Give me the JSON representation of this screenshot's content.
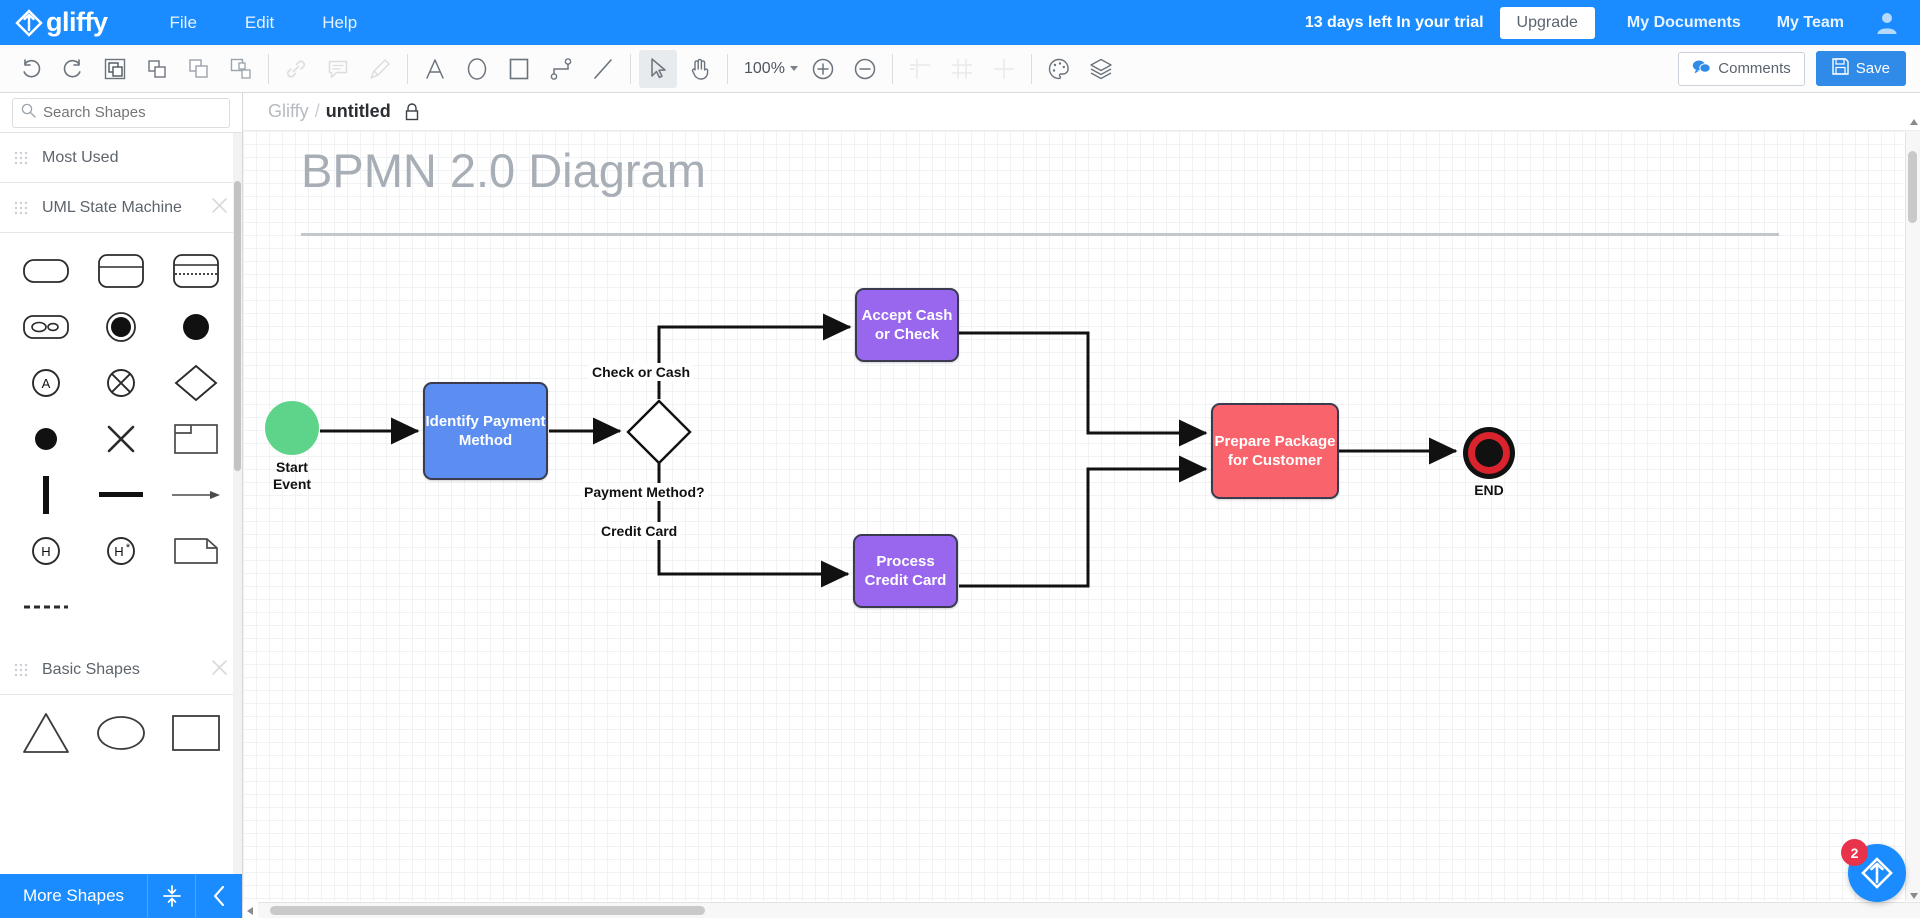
{
  "header": {
    "logo_text": "gliffy",
    "logo_icon": "gliffy-logo-icon",
    "menu": [
      {
        "label": "File"
      },
      {
        "label": "Edit"
      },
      {
        "label": "Help"
      }
    ],
    "trial_text": "13 days left In your trial",
    "upgrade_label": "Upgrade",
    "my_documents_label": "My Documents",
    "my_team_label": "My Team",
    "avatar_icon": "user-avatar-icon"
  },
  "toolbar": {
    "groups": [
      {
        "name": "history-and-arrange",
        "buttons": [
          {
            "name": "undo-button",
            "icon": "undo-icon",
            "enabled": true
          },
          {
            "name": "redo-button",
            "icon": "redo-icon",
            "enabled": true
          },
          {
            "name": "bring-to-front-button",
            "icon": "bring-to-front-icon",
            "enabled": true
          },
          {
            "name": "bring-forward-button",
            "icon": "bring-forward-icon",
            "enabled": true
          },
          {
            "name": "send-backward-button",
            "icon": "send-backward-icon",
            "enabled": true
          },
          {
            "name": "send-to-back-button",
            "icon": "send-to-back-icon",
            "enabled": true
          }
        ]
      },
      {
        "name": "object-actions",
        "buttons": [
          {
            "name": "link-button",
            "icon": "link-icon",
            "enabled": false
          },
          {
            "name": "comment-button",
            "icon": "comment-icon",
            "enabled": false
          },
          {
            "name": "format-painter-button",
            "icon": "format-painter-icon",
            "enabled": false
          }
        ]
      },
      {
        "name": "insert-shapes",
        "buttons": [
          {
            "name": "text-tool-button",
            "icon": "text-a-icon",
            "enabled": true
          },
          {
            "name": "ellipse-tool-button",
            "icon": "ellipse-icon",
            "enabled": true
          },
          {
            "name": "rectangle-tool-button",
            "icon": "rectangle-icon",
            "enabled": true
          },
          {
            "name": "connector-tool-button",
            "icon": "elbow-connector-icon",
            "enabled": true
          },
          {
            "name": "line-tool-button",
            "icon": "line-icon",
            "enabled": true
          }
        ]
      },
      {
        "name": "pointer-tools",
        "buttons": [
          {
            "name": "select-tool-button",
            "icon": "cursor-arrow-icon",
            "enabled": true,
            "active": true
          },
          {
            "name": "pan-tool-button",
            "icon": "hand-icon",
            "enabled": true
          }
        ]
      },
      {
        "name": "zoom-tools",
        "zoom_level": "100%",
        "buttons": [
          {
            "name": "zoom-in-button",
            "icon": "zoom-in-icon",
            "enabled": true
          },
          {
            "name": "zoom-out-button",
            "icon": "zoom-out-icon",
            "enabled": true
          }
        ]
      },
      {
        "name": "guides-and-grid",
        "buttons": [
          {
            "name": "rulers-button",
            "icon": "rulers-icon",
            "enabled": true
          },
          {
            "name": "grid-button",
            "icon": "grid-icon",
            "enabled": true
          },
          {
            "name": "snap-button",
            "icon": "snap-crosshair-icon",
            "enabled": true
          }
        ]
      },
      {
        "name": "style-tools",
        "buttons": [
          {
            "name": "theme-button",
            "icon": "palette-icon",
            "enabled": true
          },
          {
            "name": "layers-button",
            "icon": "layers-icon",
            "enabled": true
          }
        ]
      }
    ],
    "comments_label": "Comments",
    "comments_icon": "comments-bubble-icon",
    "save_label": "Save",
    "save_icon": "floppy-disk-icon"
  },
  "sidebar": {
    "search": {
      "placeholder": "Search Shapes",
      "value": "",
      "icon": "search-icon"
    },
    "sections": [
      {
        "name": "most-used",
        "title": "Most Used",
        "closable": false,
        "shapes": []
      },
      {
        "name": "uml-state-machine",
        "title": "UML State Machine",
        "closable": true,
        "shapes": [
          "rounded-rect-icon",
          "rounded-rect-divided-icon",
          "rounded-rect-dashed-icon",
          "composite-state-icon",
          "initial-state-ring-icon",
          "filled-circle-icon",
          "circle-a-icon",
          "circle-cross-icon",
          "diamond-icon",
          "solid-dot-icon",
          "x-cross-icon",
          "note-box-icon",
          "vertical-bar-icon",
          "horizontal-bar-icon",
          "arrow-right-icon",
          "history-h-icon",
          "deep-history-h-icon",
          "folded-note-icon",
          "dashed-line-icon"
        ]
      },
      {
        "name": "basic-shapes",
        "title": "Basic Shapes",
        "closable": true,
        "shapes": [
          "triangle-icon",
          "ellipse-icon",
          "rectangle-icon"
        ]
      }
    ],
    "footer": {
      "more_shapes_label": "More Shapes",
      "collapse_icon": "collapse-vertical-icon",
      "hide_icon": "chevron-left-icon"
    }
  },
  "breadcrumb": {
    "root": "Gliffy",
    "separator": "/",
    "document_name": "untitled",
    "lock_icon": "lock-icon"
  },
  "canvas": {
    "diagram_title": "BPMN 2.0 Diagram",
    "zoom": "100%",
    "colors": {
      "start_green": "#5ed48a",
      "task_blue": "#5b8ef0",
      "task_purple": "#9966ee",
      "task_red": "#f9636b",
      "end_red": "#d9232d",
      "stroke": "#3b3b4f",
      "connector": "#111111"
    },
    "nodes": [
      {
        "name": "start-event-node",
        "type": "circle",
        "label": "Start\nEvent",
        "color": "#5ed48a"
      },
      {
        "name": "identify-payment-method-node",
        "type": "task",
        "label": "Identify Payment Method",
        "color": "#5b8ef0"
      },
      {
        "name": "payment-method-gateway-node",
        "type": "diamond",
        "label": "",
        "color": "#ffffff"
      },
      {
        "name": "accept-cash-or-check-node",
        "type": "task",
        "label": "Accept Cash or Check",
        "color": "#9966ee"
      },
      {
        "name": "process-credit-card-node",
        "type": "task",
        "label": "Process Credit Card",
        "color": "#9966ee"
      },
      {
        "name": "prepare-package-node",
        "type": "task",
        "label": "Prepare Package for Customer",
        "color": "#f9636b"
      },
      {
        "name": "end-event-node",
        "type": "end",
        "label": "END",
        "color": "#d9232d"
      }
    ],
    "node_text": {
      "start_line1": "Start",
      "start_line2": "Event",
      "identify_line1": "Identify Payment",
      "identify_line2": "Method",
      "accept_line1": "Accept Cash",
      "accept_line2": "or Check",
      "process_line1": "Process",
      "process_line2": "Credit Card",
      "prepare_line1": "Prepare Package",
      "prepare_line2": "for Customer",
      "end_label": "END"
    },
    "edge_labels": {
      "check_or_cash": "Check or Cash",
      "payment_method": "Payment Method?",
      "credit_card": "Credit Card"
    }
  },
  "help_fab": {
    "badge_count": "2",
    "icon": "gliffy-help-icon"
  }
}
